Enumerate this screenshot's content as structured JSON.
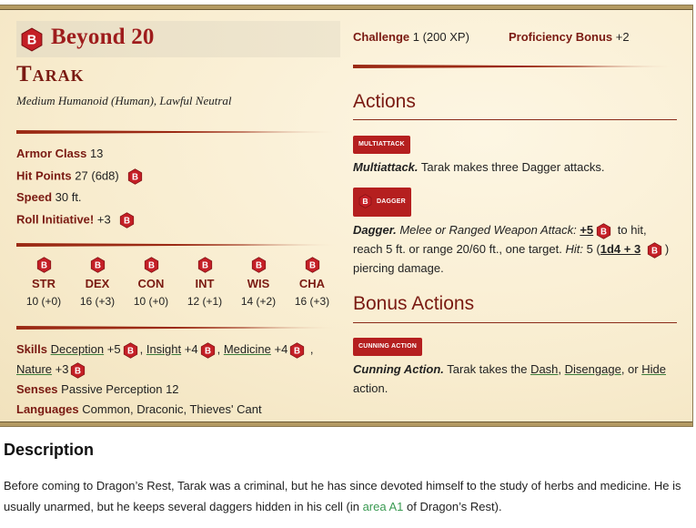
{
  "brand": {
    "name": "Beyond 20"
  },
  "monster": {
    "name": "Tarak",
    "meta": "Medium Humanoid (Human), Lawful Neutral"
  },
  "props": {
    "ac_label": "Armor Class",
    "ac_value": "13",
    "hp_label": "Hit Points",
    "hp_value": "27 (6d8)",
    "speed_label": "Speed",
    "speed_value": "30 ft.",
    "init_label": "Roll Initiative!",
    "init_value": "+3"
  },
  "abilities": [
    {
      "name": "STR",
      "value": "10 (+0)"
    },
    {
      "name": "DEX",
      "value": "16 (+3)"
    },
    {
      "name": "CON",
      "value": "10 (+0)"
    },
    {
      "name": "INT",
      "value": "12 (+1)"
    },
    {
      "name": "WIS",
      "value": "14 (+2)"
    },
    {
      "name": "CHA",
      "value": "16 (+3)"
    }
  ],
  "skills": {
    "label": "Skills",
    "items": [
      {
        "name": "Deception",
        "bonus": "+5"
      },
      {
        "name": "Insight",
        "bonus": "+4"
      },
      {
        "name": "Medicine",
        "bonus": "+4"
      },
      {
        "name": "Nature",
        "bonus": "+3"
      }
    ],
    "senses_label": "Senses",
    "senses_value": "Passive Perception 12",
    "languages_label": "Languages",
    "languages_value": "Common, Draconic, Thieves' Cant"
  },
  "header_right": {
    "challenge_label": "Challenge",
    "challenge_value": "1 (200 XP)",
    "prof_label": "Proficiency Bonus",
    "prof_value": "+2"
  },
  "actions": {
    "title": "Actions",
    "multiattack_tag": "Multiattack",
    "multiattack_name": "Multiattack.",
    "multiattack_text": "Tarak makes three Dagger attacks.",
    "dagger_tag": "Dagger",
    "dagger_name": "Dagger.",
    "dagger_type": "Melee or Ranged Weapon Attack:",
    "dagger_bonus": "+5",
    "dagger_to_hit": "to hit,",
    "dagger_reach": "reach 5 ft. or range 20/60 ft., one target.",
    "dagger_hit_label": "Hit:",
    "dagger_damage_avg": "5",
    "dagger_damage_dice": "1d4 + 3",
    "dagger_damage_type": "piercing damage."
  },
  "bonus_actions": {
    "title": "Bonus Actions",
    "cunning_tag": "Cunning Action",
    "cunning_name": "Cunning Action.",
    "cunning_pre": "Tarak takes the",
    "dash": "Dash",
    "disengage": "Disengage",
    "or": ", or",
    "hide": "Hide",
    "cunning_post": "action."
  },
  "description": {
    "title": "Description",
    "text_1": "Before coming to Dragon’s Rest, Tarak was a criminal, but he has since devoted himself to the study of herbs and medicine. He is usually unarmed, but he keeps several daggers hidden in his cell (in",
    "link": "area A1",
    "text_2": "of Dragon’s Rest)."
  },
  "icons": {
    "brand_icon": "beyond20-hexagon-icon"
  },
  "colors": {
    "accent": "#b51f1f",
    "heading": "#7a1a12",
    "link": "#3a9a52"
  }
}
